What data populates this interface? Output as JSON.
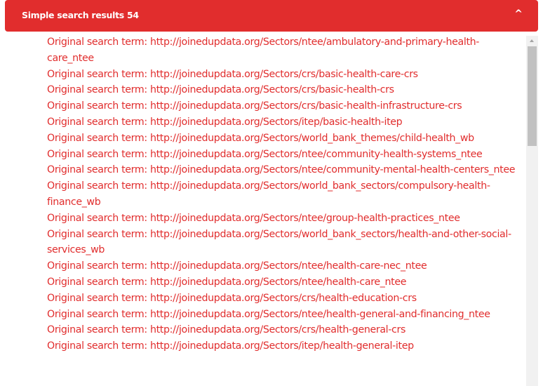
{
  "header": {
    "title": "Simple search results 54",
    "collapse_icon": "^"
  },
  "results": [
    "Original search term: http://joinedupdata.org/Sectors/ntee/ambulatory-and-primary-health-care_ntee",
    "Original search term: http://joinedupdata.org/Sectors/crs/basic-health-care-crs",
    "Original search term: http://joinedupdata.org/Sectors/crs/basic-health-crs",
    "Original search term: http://joinedupdata.org/Sectors/crs/basic-health-infrastructure-crs",
    "Original search term: http://joinedupdata.org/Sectors/itep/basic-health-itep",
    "Original search term: http://joinedupdata.org/Sectors/world_bank_themes/child-health_wb",
    "Original search term: http://joinedupdata.org/Sectors/ntee/community-health-systems_ntee",
    "Original search term: http://joinedupdata.org/Sectors/ntee/community-mental-health-centers_ntee",
    "Original search term: http://joinedupdata.org/Sectors/world_bank_sectors/compulsory-health-finance_wb",
    "Original search term: http://joinedupdata.org/Sectors/ntee/group-health-practices_ntee",
    "Original search term: http://joinedupdata.org/Sectors/world_bank_sectors/health-and-other-social-services_wb",
    "Original search term: http://joinedupdata.org/Sectors/ntee/health-care-nec_ntee",
    "Original search term: http://joinedupdata.org/Sectors/ntee/health-care_ntee",
    "Original search term: http://joinedupdata.org/Sectors/crs/health-education-crs",
    "Original search term: http://joinedupdata.org/Sectors/ntee/health-general-and-financing_ntee",
    "Original search term: http://joinedupdata.org/Sectors/crs/health-general-crs",
    "Original search term: http://joinedupdata.org/Sectors/itep/health-general-itep"
  ],
  "colors": {
    "accent": "#e12d2d",
    "header_text": "#ffffff",
    "scroll_track": "#f1f1f1",
    "scroll_thumb": "#c1c1c1"
  },
  "icons": {
    "collapse": "chevron-up-icon",
    "scroll_up": "scroll-up-arrow-icon"
  }
}
